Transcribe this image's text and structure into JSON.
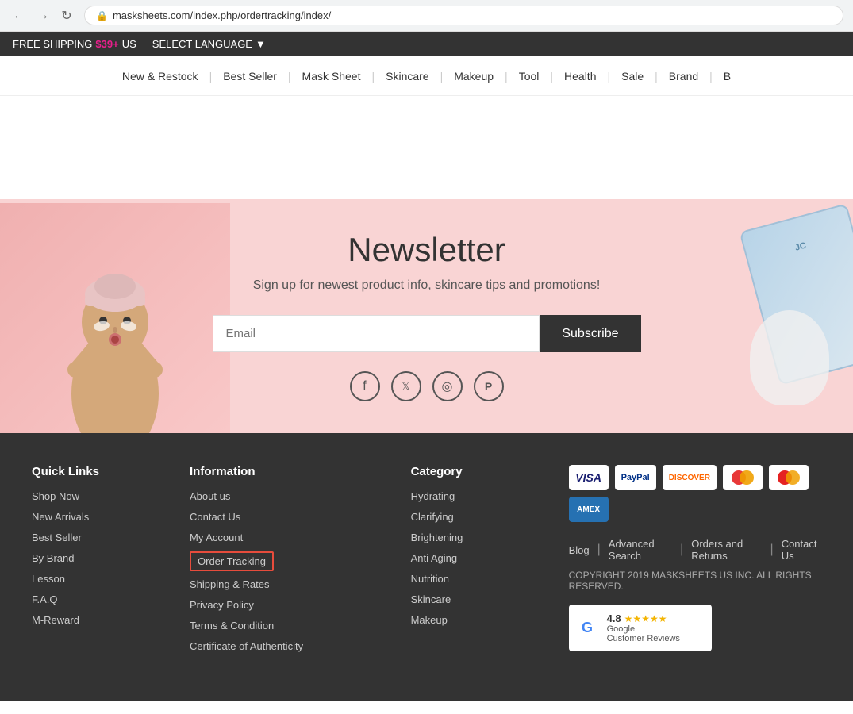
{
  "browser": {
    "url": "masksheets.com/index.php/ordertracking/index/",
    "back_label": "←",
    "forward_label": "→",
    "refresh_label": "↻"
  },
  "announcement": {
    "free_shipping": "FREE SHIPPING",
    "price": "$39+",
    "region": "US",
    "language": "SELECT LANGUAGE",
    "dropdown_arrow": "▼"
  },
  "nav": {
    "items": [
      {
        "label": "New & Restock"
      },
      {
        "label": "Best Seller"
      },
      {
        "label": "Mask Sheet"
      },
      {
        "label": "Skincare"
      },
      {
        "label": "Makeup"
      },
      {
        "label": "Tool"
      },
      {
        "label": "Health"
      },
      {
        "label": "Sale"
      },
      {
        "label": "Brand"
      },
      {
        "label": "B"
      }
    ]
  },
  "newsletter": {
    "title": "Newsletter",
    "subtitle": "Sign up for newest product info, skincare tips and promotions!",
    "email_placeholder": "Email",
    "subscribe_label": "Subscribe"
  },
  "social": {
    "facebook": "f",
    "twitter": "𝕏",
    "instagram": "◎",
    "pinterest": "p"
  },
  "footer": {
    "quick_links": {
      "heading": "Quick Links",
      "items": [
        {
          "label": "Shop Now"
        },
        {
          "label": "New Arrivals"
        },
        {
          "label": "Best Seller"
        },
        {
          "label": "By Brand"
        },
        {
          "label": "Lesson"
        },
        {
          "label": "F.A.Q"
        },
        {
          "label": "M-Reward"
        }
      ]
    },
    "information": {
      "heading": "Information",
      "items": [
        {
          "label": "About us"
        },
        {
          "label": "Contact Us"
        },
        {
          "label": "My Account"
        },
        {
          "label": "Order Tracking",
          "highlighted": true
        },
        {
          "label": "Shipping & Rates"
        },
        {
          "label": "Privacy Policy"
        },
        {
          "label": "Terms & Condition"
        },
        {
          "label": "Certificate of Authenticity"
        }
      ]
    },
    "category": {
      "heading": "Category",
      "items": [
        {
          "label": "Hydrating"
        },
        {
          "label": "Clarifying"
        },
        {
          "label": "Brightening"
        },
        {
          "label": "Anti Aging"
        },
        {
          "label": "Nutrition"
        },
        {
          "label": "Skincare"
        },
        {
          "label": "Makeup"
        }
      ]
    },
    "payments": {
      "icons": [
        "VISA",
        "PayPal",
        "DISCOVER",
        "Maestro",
        "MasterCard",
        "AMEX"
      ]
    },
    "bottom_links": [
      {
        "label": "Blog"
      },
      {
        "label": "Advanced Search"
      },
      {
        "label": "Orders and Returns"
      },
      {
        "label": "Contact Us"
      }
    ],
    "copyright": "COPYRIGHT 2019 MASKSHEETS US INC. ALL RIGHTS RESERVED.",
    "google_reviews": {
      "rating": "4.8",
      "stars": "★★★★★",
      "label_1": "Google",
      "label_2": "Customer Reviews"
    }
  }
}
